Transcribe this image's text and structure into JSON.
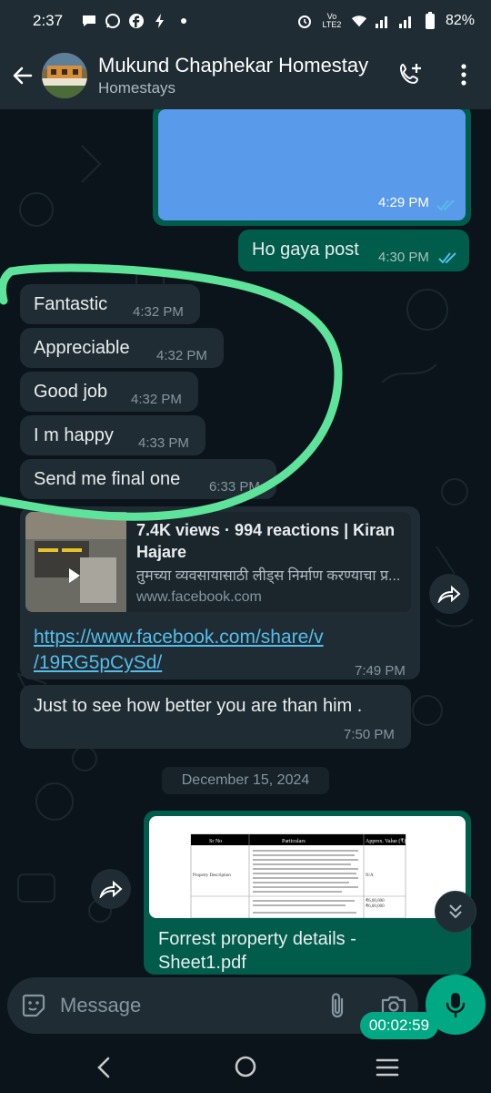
{
  "status_bar": {
    "time": "2:37",
    "network_label": "Vo LTE2",
    "battery": "82%"
  },
  "header": {
    "contact_name": "Mukund Chaphekar Homestay",
    "subtitle": "Homestays"
  },
  "messages": [
    {
      "text": "",
      "time": "4:29 PM",
      "direction": "out",
      "type": "image"
    },
    {
      "text": "Ho gaya post",
      "time": "4:30 PM",
      "direction": "out"
    },
    {
      "text": "Fantastic",
      "time": "4:32 PM",
      "direction": "in"
    },
    {
      "text": "Appreciable",
      "time": "4:32 PM",
      "direction": "in"
    },
    {
      "text": "Good job",
      "time": "4:32 PM",
      "direction": "in"
    },
    {
      "text": "I m happy",
      "time": "4:33 PM",
      "direction": "in"
    },
    {
      "text": "Send me final one",
      "time": "6:33 PM",
      "direction": "in"
    },
    {
      "text": "Just to see how better you  are than him .",
      "time": "7:50 PM",
      "direction": "in"
    }
  ],
  "link_message": {
    "preview_title": "7.4K views · 994 reactions | Kiran Hajare",
    "preview_description": "तुमच्या व्यवसायासाठी लीड्स निर्माण करण्याचा प्र...",
    "preview_domain": "www.facebook.com",
    "url_line1": "https://www.facebook.com/share/v",
    "url_line2": "/19RG5pCySd/",
    "time": "7:49 PM"
  },
  "date_divider": "December 15, 2024",
  "document_message": {
    "file_name_line1": "Forrest property details -",
    "file_name_line2": "Sheet1.pdf",
    "preview": {
      "headers": [
        "Sr No",
        "Particulars",
        "Approx. Value (₹)"
      ],
      "row_label": "Property Description",
      "row_value": "N/A",
      "amounts": [
        "₹6,00,000",
        "₹6,00,000"
      ]
    }
  },
  "composer": {
    "placeholder": "Message",
    "recording_timer": "00:02:59"
  },
  "colors": {
    "incoming_bubble": "#202c33",
    "outgoing_bubble": "#005c4b",
    "accent": "#00a884",
    "annotation_stroke": "#5ee39a",
    "link": "#53bdeb"
  },
  "icons": [
    "back-arrow-icon",
    "add-call-icon",
    "more-vert-icon",
    "forward-icon",
    "double-chevron-down-icon",
    "sticker-icon",
    "attach-icon",
    "camera-icon",
    "mic-icon",
    "double-check-icon"
  ]
}
